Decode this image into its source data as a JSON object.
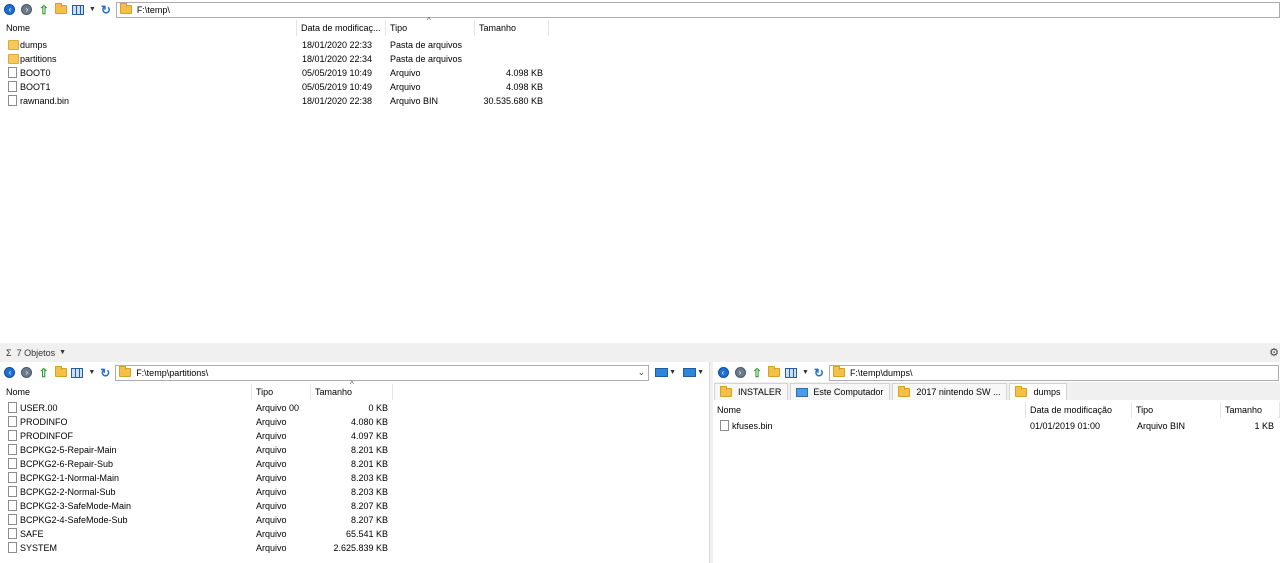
{
  "top": {
    "path": "F:\\temp\\",
    "columns": {
      "name": "Nome",
      "date": "Data de modificaç...",
      "type": "Tipo",
      "size": "Tamanho"
    },
    "rows": [
      {
        "icon": "folder-icon",
        "name": "dumps",
        "date": "18/01/2020 22:33",
        "type": "Pasta de arquivos",
        "size": ""
      },
      {
        "icon": "folder-icon",
        "name": "partitions",
        "date": "18/01/2020 22:34",
        "type": "Pasta de arquivos",
        "size": ""
      },
      {
        "icon": "file-icon",
        "name": "BOOT0",
        "date": "05/05/2019 10:49",
        "type": "Arquivo",
        "size": "4.098 KB"
      },
      {
        "icon": "file-icon",
        "name": "BOOT1",
        "date": "05/05/2019 10:49",
        "type": "Arquivo",
        "size": "4.098 KB"
      },
      {
        "icon": "file-icon",
        "name": "rawnand.bin",
        "date": "18/01/2020 22:38",
        "type": "Arquivo BIN",
        "size": "30.535.680 KB"
      }
    ]
  },
  "status": {
    "sigma": "Σ",
    "count": "7 Objetos"
  },
  "bottom_left": {
    "path": "F:\\temp\\partitions\\",
    "columns": {
      "name": "Nome",
      "type": "Tipo",
      "size": "Tamanho"
    },
    "rows": [
      {
        "name": "USER.00",
        "type": "Arquivo 00",
        "size": "0 KB"
      },
      {
        "name": "PRODINFO",
        "type": "Arquivo",
        "size": "4.080 KB"
      },
      {
        "name": "PRODINFOF",
        "type": "Arquivo",
        "size": "4.097 KB"
      },
      {
        "name": "BCPKG2-5-Repair-Main",
        "type": "Arquivo",
        "size": "8.201 KB"
      },
      {
        "name": "BCPKG2-6-Repair-Sub",
        "type": "Arquivo",
        "size": "8.201 KB"
      },
      {
        "name": "BCPKG2-1-Normal-Main",
        "type": "Arquivo",
        "size": "8.203 KB"
      },
      {
        "name": "BCPKG2-2-Normal-Sub",
        "type": "Arquivo",
        "size": "8.203 KB"
      },
      {
        "name": "BCPKG2-3-SafeMode-Main",
        "type": "Arquivo",
        "size": "8.207 KB"
      },
      {
        "name": "BCPKG2-4-SafeMode-Sub",
        "type": "Arquivo",
        "size": "8.207 KB"
      },
      {
        "name": "SAFE",
        "type": "Arquivo",
        "size": "65.541 KB"
      },
      {
        "name": "SYSTEM",
        "type": "Arquivo",
        "size": "2.625.839 KB"
      }
    ]
  },
  "bottom_right": {
    "path": "F:\\temp\\dumps\\",
    "tabs": [
      {
        "label": "INSTALER",
        "icon": "folder-icon"
      },
      {
        "label": "Este Computador",
        "icon": "computer-icon"
      },
      {
        "label": "2017 nintendo SW ...",
        "icon": "folder-icon"
      },
      {
        "label": "dumps",
        "icon": "folder-icon"
      }
    ],
    "columns": {
      "name": "Nome",
      "date": "Data de modificação",
      "type": "Tipo",
      "size": "Tamanho"
    },
    "rows": [
      {
        "name": "kfuses.bin",
        "date": "01/01/2019 01:00",
        "type": "Arquivo BIN",
        "size": "1 KB"
      }
    ]
  }
}
